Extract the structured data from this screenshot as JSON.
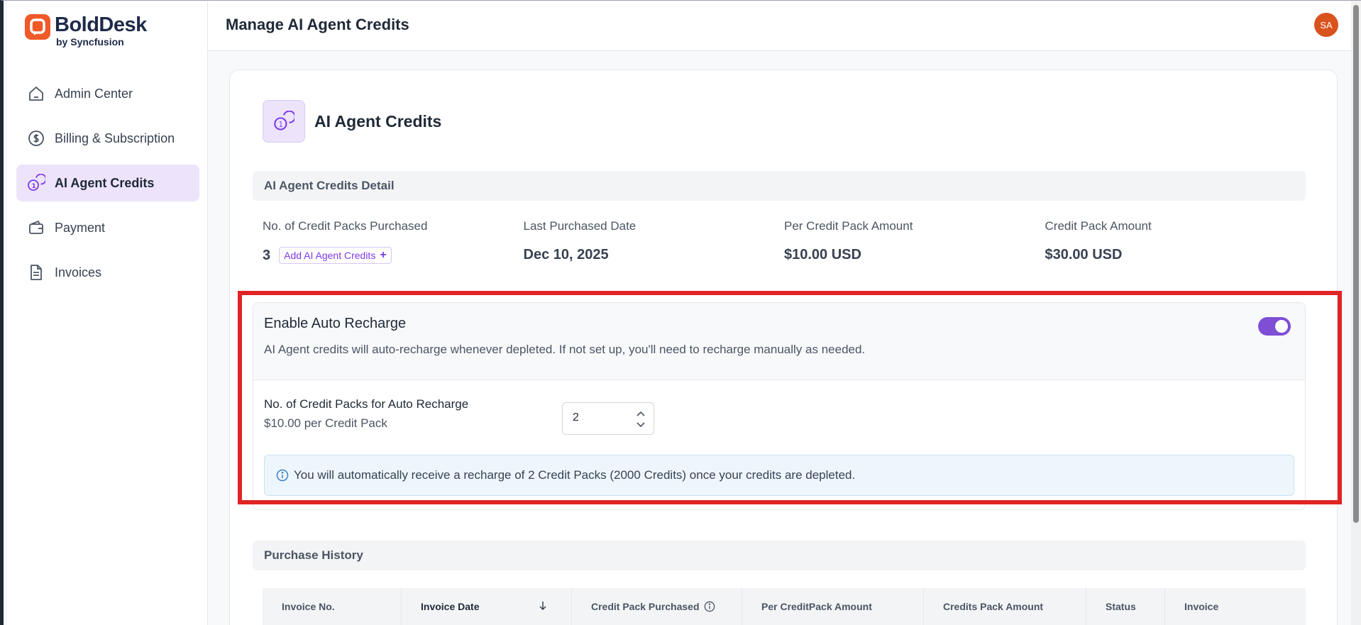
{
  "brand": {
    "name": "BoldDesk",
    "sub": "by Syncfusion"
  },
  "sidebar": {
    "items": [
      {
        "label": "Admin Center",
        "icon": "home-icon"
      },
      {
        "label": "Billing & Subscription",
        "icon": "dollar-icon"
      },
      {
        "label": "AI Agent Credits",
        "icon": "credits-icon",
        "active": true
      },
      {
        "label": "Payment",
        "icon": "wallet-icon"
      },
      {
        "label": "Invoices",
        "icon": "document-icon"
      }
    ]
  },
  "header": {
    "title": "Manage AI Agent Credits",
    "avatar_initials": "SA"
  },
  "card": {
    "title": "AI Agent Credits",
    "detail_section": "AI Agent Credits Detail",
    "details": [
      {
        "label": "No. of Credit Packs Purchased",
        "value": "3"
      },
      {
        "label": "Last Purchased Date",
        "value": "Dec 10, 2025"
      },
      {
        "label": "Per Credit Pack Amount",
        "value": "$10.00 USD"
      },
      {
        "label": "Credit Pack Amount",
        "value": "$30.00 USD"
      }
    ],
    "add_credits_label": "Add AI Agent Credits",
    "auto_recharge": {
      "title": "Enable Auto Recharge",
      "description": "AI Agent credits will auto-recharge whenever depleted. If not set up, you'll need to recharge manually as needed.",
      "enabled": true,
      "packs_label": "No. of Credit Packs for Auto Recharge",
      "packs_sub": "$10.00 per Credit Pack",
      "packs_value": "2",
      "info": "You will automatically receive a recharge of 2 Credit Packs (2000 Credits) once your credits are depleted."
    },
    "history_section": "Purchase History",
    "table_columns": [
      "Invoice No.",
      "Invoice Date",
      "Credit Pack Purchased",
      "Per CreditPack Amount",
      "Credits Pack Amount",
      "Status",
      "Invoice"
    ]
  },
  "colors": {
    "accent": "#7e4fd4",
    "brand": "#f05a28",
    "highlight": "#e02424"
  }
}
